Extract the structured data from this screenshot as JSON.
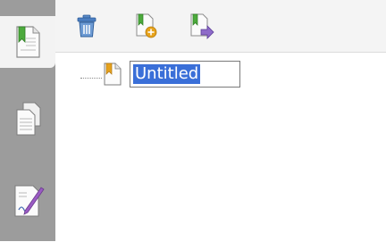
{
  "side_panel": {
    "tabs": [
      {
        "icon": "bookmarks-icon",
        "active": true
      },
      {
        "icon": "pages-icon",
        "active": false
      },
      {
        "icon": "signature-icon",
        "active": false
      }
    ]
  },
  "toolbar": {
    "buttons": [
      {
        "icon": "trash-icon"
      },
      {
        "icon": "new-bookmark-icon"
      },
      {
        "icon": "move-bookmark-icon"
      }
    ]
  },
  "tree": {
    "node": {
      "icon": "bookmark-node-icon",
      "rename_value": "Untitled"
    }
  },
  "colors": {
    "side_strip": "#9c9c9c",
    "selection": "#3a6fd8",
    "bookmark_green": "#4caa3c",
    "bookmark_orange": "#e6a21c"
  }
}
